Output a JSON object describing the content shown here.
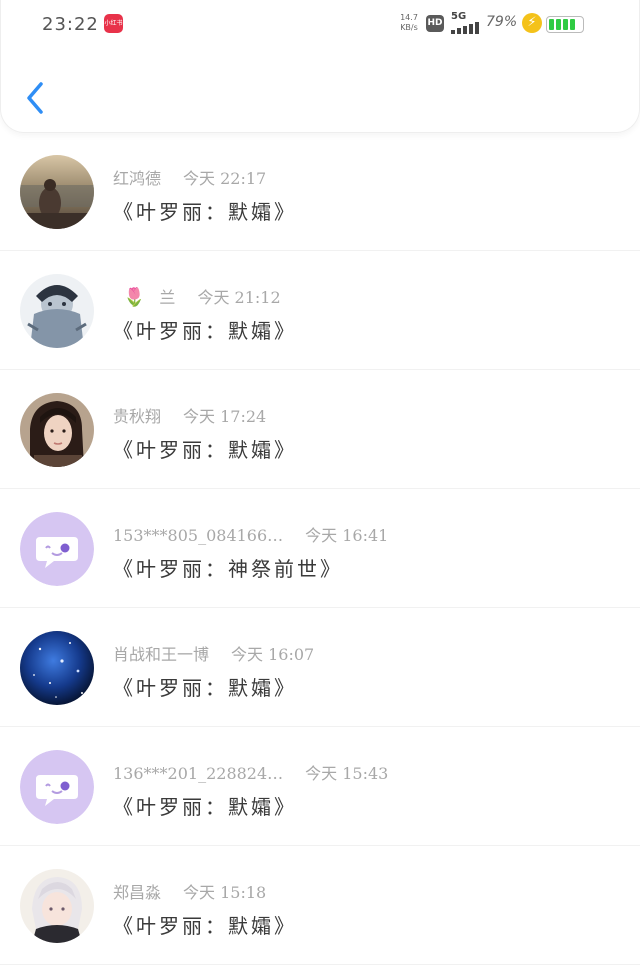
{
  "status_bar": {
    "time": "23:22",
    "app_badge": "小红书",
    "speed_value": "14.7",
    "speed_unit": "KB/s",
    "hd": "HD",
    "network": "5G",
    "battery_percent": "79%",
    "battery_level": 0.79,
    "colors": {
      "app_badge": "#e8324a",
      "bolt": "#f4c21a",
      "battery": "#2fcb43"
    }
  },
  "header": {
    "back_icon": "chevron-left-icon",
    "accent_color": "#2f8ef5"
  },
  "comments": [
    {
      "name": "红鸿德",
      "time": "今天 22:17",
      "message": "《叶罗丽：默孀》",
      "avatar": "photo-sunset-person"
    },
    {
      "name": "兰",
      "emoji": "🌷",
      "time": "今天 21:12",
      "message": "《叶罗丽：默孀》",
      "avatar": "anime-character"
    },
    {
      "name": "贵秋翔",
      "time": "今天 17:24",
      "message": "《叶罗丽：默孀》",
      "avatar": "photo-girl"
    },
    {
      "name": "153***805_084166…",
      "time": "今天 16:41",
      "message": "《叶罗丽：神祭前世》",
      "avatar": "default-chat-avatar"
    },
    {
      "name": "肖战和王一博",
      "time": "今天 16:07",
      "message": "《叶罗丽：默孀》",
      "avatar": "galaxy"
    },
    {
      "name": "136***201_228824…",
      "time": "今天 15:43",
      "message": "《叶罗丽：默孀》",
      "avatar": "default-chat-avatar"
    },
    {
      "name": "郑昌淼",
      "time": "今天 15:18",
      "message": "《叶罗丽：默孀》",
      "avatar": "anime-white-hair"
    }
  ]
}
